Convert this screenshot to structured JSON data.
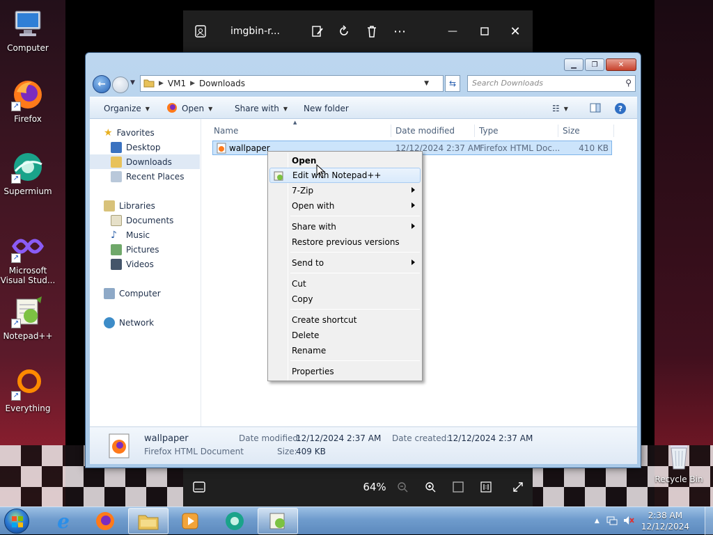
{
  "desktop": {
    "icons": [
      {
        "label_line1": "Computer",
        "label_line2": ""
      },
      {
        "label_line1": "Firefox",
        "label_line2": ""
      },
      {
        "label_line1": "Supermium",
        "label_line2": ""
      },
      {
        "label_line1": "Microsoft",
        "label_line2": "Visual Stud..."
      },
      {
        "label_line1": "Notepad++",
        "label_line2": ""
      },
      {
        "label_line1": "Everything",
        "label_line2": ""
      }
    ],
    "recycle_bin": "Recycle Bin"
  },
  "viewer": {
    "filename": "imgbin-r...",
    "zoom": "64%"
  },
  "explorer": {
    "address": [
      "VM1",
      "Downloads"
    ],
    "search_placeholder": "Search Downloads",
    "toolbar": {
      "organize": "Organize",
      "open": "Open",
      "share_with": "Share with",
      "new_folder": "New folder"
    },
    "sidebar": {
      "favorites": "Favorites",
      "desktop": "Desktop",
      "downloads": "Downloads",
      "recent_places": "Recent Places",
      "libraries": "Libraries",
      "documents": "Documents",
      "music": "Music",
      "pictures": "Pictures",
      "videos": "Videos",
      "computer": "Computer",
      "network": "Network"
    },
    "columns": {
      "name": "Name",
      "date_modified": "Date modified",
      "type": "Type",
      "size": "Size"
    },
    "file": {
      "name": "wallpaper",
      "date_modified": "12/12/2024 2:37 AM",
      "type": "Firefox HTML Doc...",
      "size": "410 KB"
    },
    "details": {
      "name": "wallpaper",
      "type": "Firefox HTML Document",
      "date_modified_label": "Date modified:",
      "date_modified": "12/12/2024 2:37 AM",
      "size_label": "Size:",
      "size": "409 KB",
      "date_created_label": "Date created:",
      "date_created": "12/12/2024 2:37 AM"
    }
  },
  "context_menu": {
    "open": "Open",
    "edit_notepad": "Edit with Notepad++",
    "seven_zip": "7-Zip",
    "open_with": "Open with",
    "share_with": "Share with",
    "restore": "Restore previous versions",
    "send_to": "Send to",
    "cut": "Cut",
    "copy": "Copy",
    "create_shortcut": "Create shortcut",
    "delete": "Delete",
    "rename": "Rename",
    "properties": "Properties"
  },
  "taskbar": {
    "time": "2:38 AM",
    "date": "12/12/2024"
  }
}
